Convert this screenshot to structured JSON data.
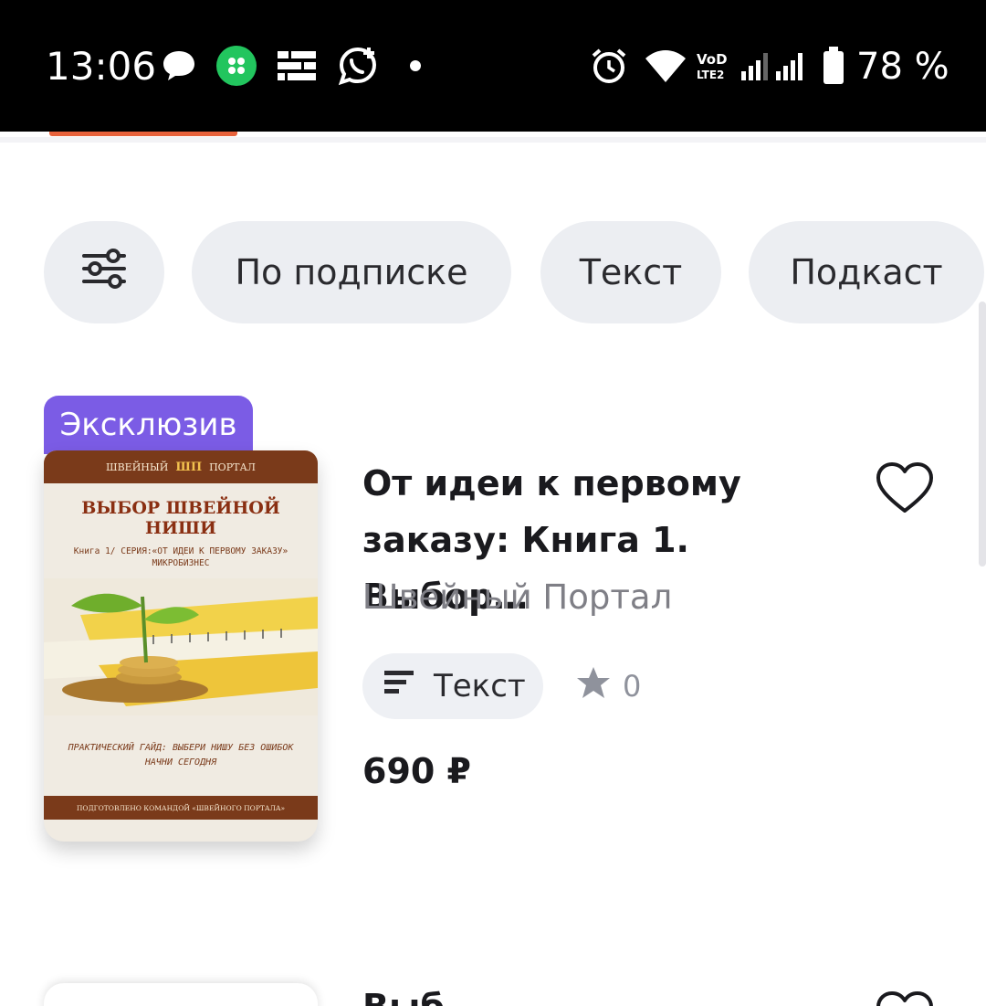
{
  "status_bar": {
    "time": "13:06",
    "battery": "78 %",
    "icons": [
      "messenger-icon",
      "app-icon",
      "notification-icon",
      "whatsapp-icon",
      "dot-icon",
      "alarm-icon",
      "wifi-icon",
      "volte-icon",
      "signal-icon",
      "battery-icon"
    ]
  },
  "filters": {
    "items": [
      {
        "label": "По подписке"
      },
      {
        "label": "Текст"
      },
      {
        "label": "Подкаст"
      }
    ]
  },
  "book": {
    "badge": "Эксклюзив",
    "title": "От идеи к первому заказу: Книга 1. Выбор…",
    "author": "Швейный Портал",
    "type_label": "Текст",
    "rating": "0",
    "price": "690 ₽",
    "cover": {
      "top_left": "ШВЕЙНЫЙ",
      "logo": "ШП",
      "top_right": "ПОРТАЛ",
      "title": "ВЫБОР ШВЕЙНОЙ НИШИ",
      "subtitle_line1": "Книга 1/ СЕРИЯ:«ОТ ИДЕИ К ПЕРВОМУ ЗАКАЗУ»",
      "subtitle_line2": "МИКРОБИЗНЕС",
      "bottom_line1": "ПРАКТИЧЕСКИЙ ГАЙД: ВЫБЕРИ НИШУ БЕЗ ОШИБОК",
      "bottom_line2": "НАЧНИ СЕГОДНЯ",
      "footer": "ПОДГОТОВЛЕНО КОМАНДОЙ «ШВЕЙНОГО ПОРТАЛА»"
    }
  },
  "next_book": {
    "title_partial": "Выб"
  },
  "colors": {
    "accent": "#e8623b",
    "badge": "#7b5ce5",
    "chip_bg": "#eceef2"
  }
}
